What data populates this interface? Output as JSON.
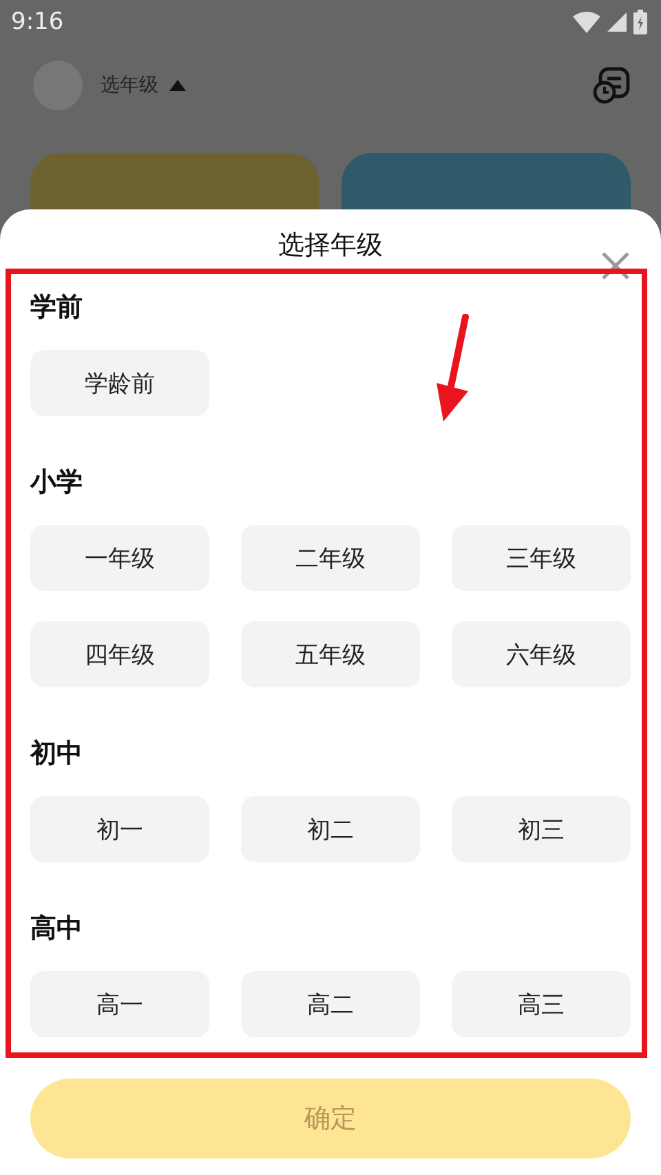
{
  "status_bar": {
    "time": "9:16"
  },
  "header": {
    "grade_picker": "选年级"
  },
  "sheet": {
    "title": "选择年级",
    "sections": [
      {
        "heading": "学前",
        "options": [
          {
            "label": "学龄前",
            "selected": false
          }
        ]
      },
      {
        "heading": "小学",
        "options": [
          {
            "label": "一年级",
            "selected": false
          },
          {
            "label": "二年级",
            "selected": false
          },
          {
            "label": "三年级",
            "selected": false
          },
          {
            "label": "四年级",
            "selected": false
          },
          {
            "label": "五年级",
            "selected": false
          },
          {
            "label": "六年级",
            "selected": false
          }
        ]
      },
      {
        "heading": "初中",
        "options": [
          {
            "label": "初一",
            "selected": false
          },
          {
            "label": "初二",
            "selected": false
          },
          {
            "label": "初三",
            "selected": false
          }
        ]
      },
      {
        "heading": "高中",
        "options": [
          {
            "label": "高一",
            "selected": false
          },
          {
            "label": "高二",
            "selected": false
          },
          {
            "label": "高三",
            "selected": false
          }
        ]
      }
    ],
    "confirm_button": {
      "label": "确定",
      "disabled": true
    }
  }
}
